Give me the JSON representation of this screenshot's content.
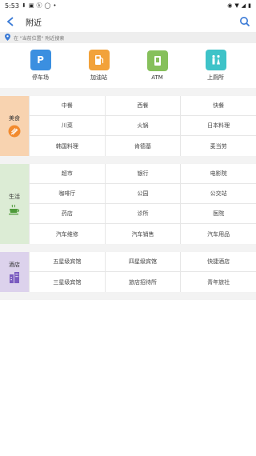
{
  "status": {
    "time": "5:53"
  },
  "appbar": {
    "title": "附近"
  },
  "location": {
    "text": "在 \"当前位置\" 附近搜索"
  },
  "quick": [
    {
      "label": "停车场",
      "icon": "parking-icon",
      "color": "#3b8fe0",
      "glyph": "P"
    },
    {
      "label": "加油站",
      "icon": "fuel-icon",
      "color": "#f2a23a",
      "glyph": "⛽"
    },
    {
      "label": "ATM",
      "icon": "atm-icon",
      "color": "#86c05b",
      "glyph": "▤"
    },
    {
      "label": "上厕所",
      "icon": "restroom-icon",
      "color": "#3ec3c8",
      "glyph": "🚻"
    }
  ],
  "sections": {
    "food": {
      "label": "美食",
      "items": [
        "中餐",
        "西餐",
        "快餐",
        "川菜",
        "火锅",
        "日本料理",
        "韩国料理",
        "肯德基",
        "麦当劳"
      ]
    },
    "life": {
      "label": "生活",
      "items": [
        "超市",
        "银行",
        "电影院",
        "咖啡厅",
        "公园",
        "公交站",
        "药店",
        "诊所",
        "医院",
        "汽车维修",
        "汽车销售",
        "汽车用品"
      ]
    },
    "hotel": {
      "label": "酒店",
      "items": [
        "五星级宾馆",
        "四星级宾馆",
        "快捷酒店",
        "三星级宾馆",
        "旅店招待所",
        "青年旅社"
      ]
    }
  }
}
